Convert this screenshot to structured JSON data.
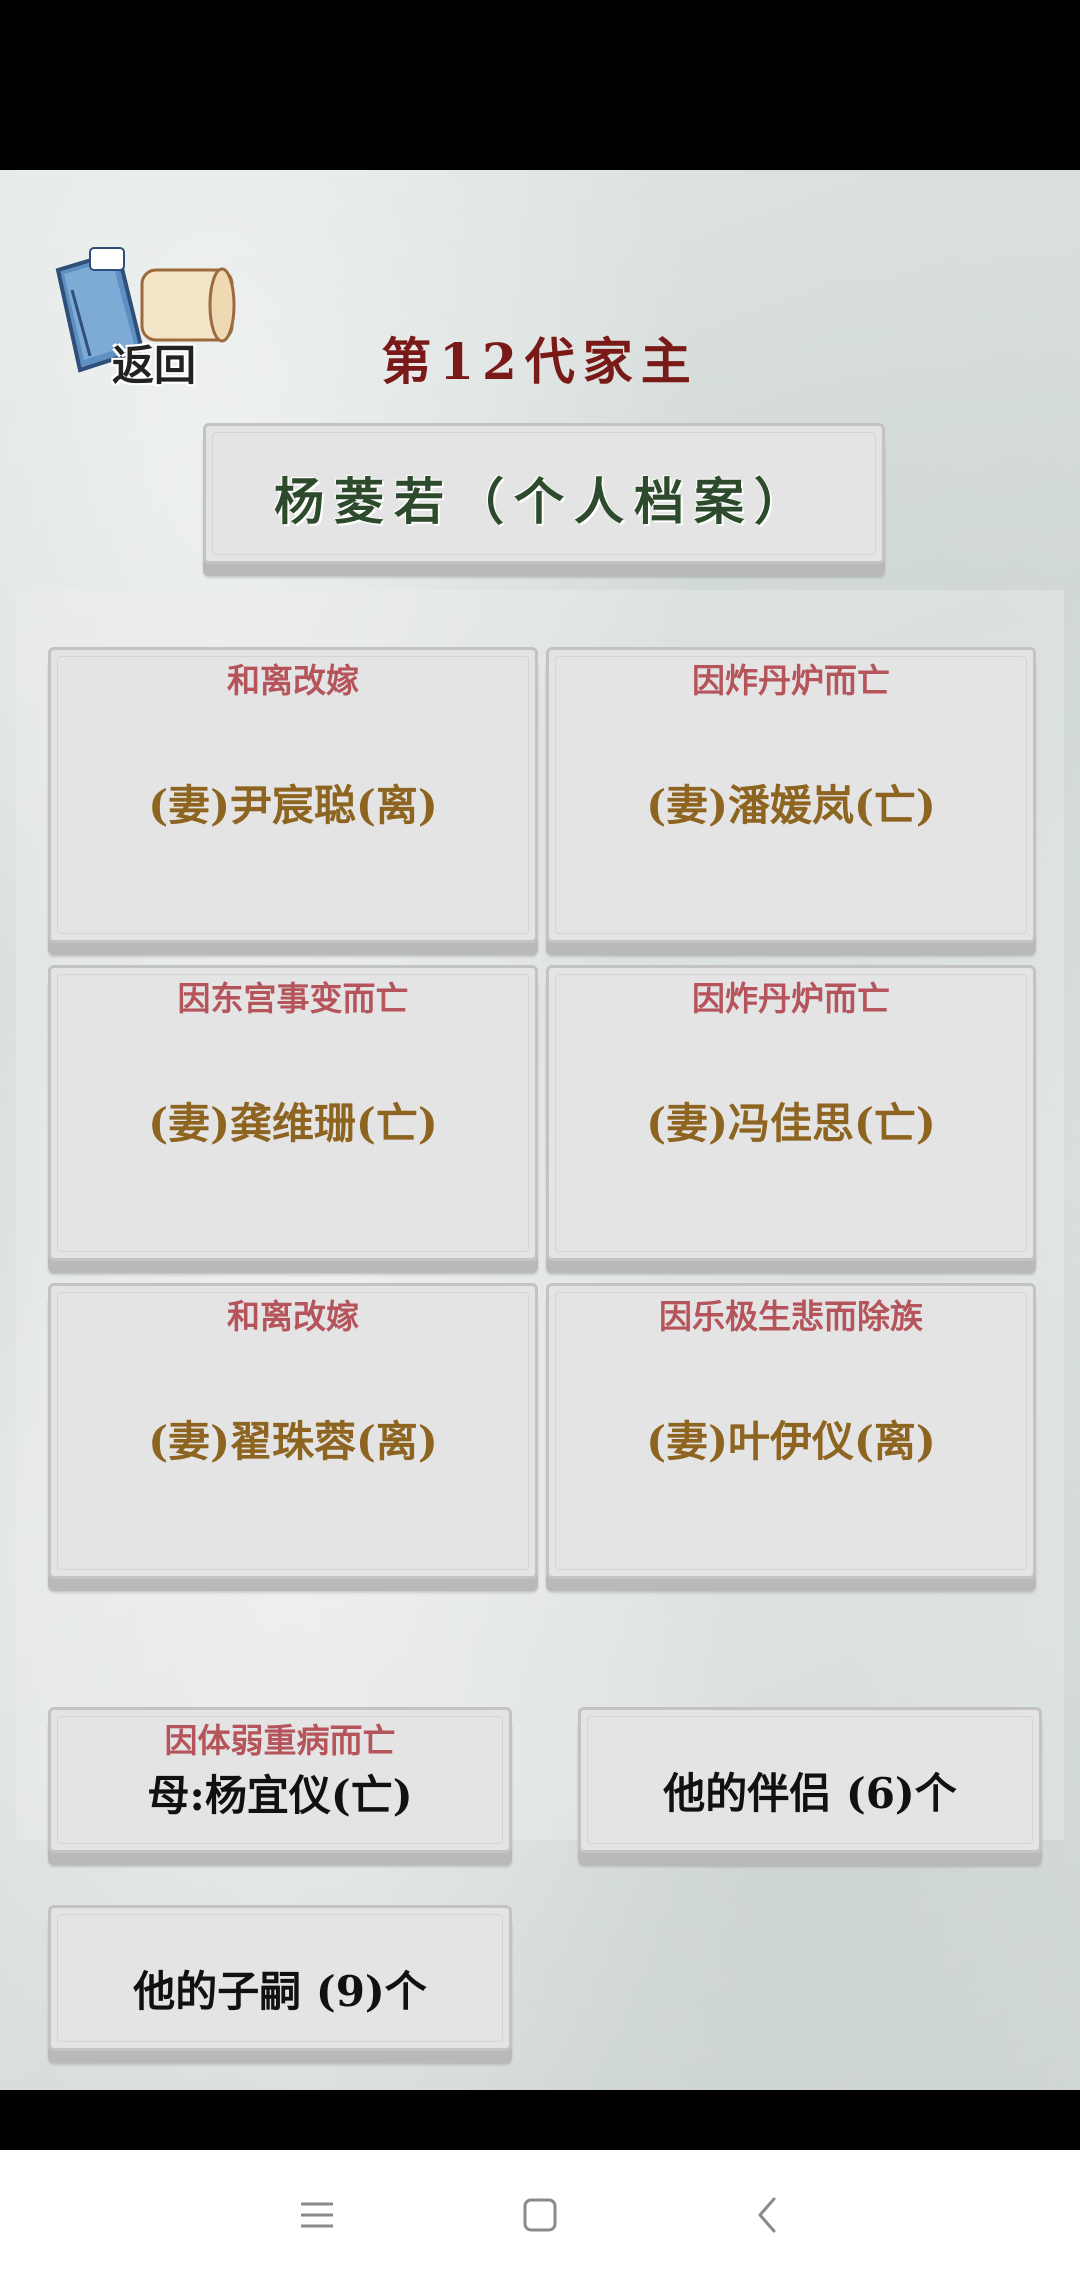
{
  "header": {
    "back_label": "返回",
    "generation_title": "第12代家主",
    "profile_title": "杨菱若（个人档案）"
  },
  "spouses": [
    {
      "fate": "和离改嫁",
      "name": "(妻)尹宸聪(离)"
    },
    {
      "fate": "因炸丹炉而亡",
      "name": "(妻)潘媛岚(亡)"
    },
    {
      "fate": "因东宫事变而亡",
      "name": "(妻)龚维珊(亡)"
    },
    {
      "fate": "因炸丹炉而亡",
      "name": "(妻)冯佳思(亡)"
    },
    {
      "fate": "和离改嫁",
      "name": "(妻)翟珠蓉(离)"
    },
    {
      "fate": "因乐极生悲而除族",
      "name": "(妻)叶伊仪(离)"
    }
  ],
  "mother": {
    "fate": "因体弱重病而亡",
    "label": "母:杨宜仪(亡)"
  },
  "partners_button": "他的伴侣 (6)个",
  "children_button": "他的子嗣 (9)个",
  "nav": {
    "menu_icon": "menu-icon",
    "home_icon": "home-icon",
    "back_icon": "back-arrow-icon"
  },
  "colors": {
    "title": "#7a1a18",
    "profile_title": "#2d4a2c",
    "fate_text": "#b5555b",
    "spouse_name": "#8d6420",
    "card_bg": "#e4e4e4"
  }
}
